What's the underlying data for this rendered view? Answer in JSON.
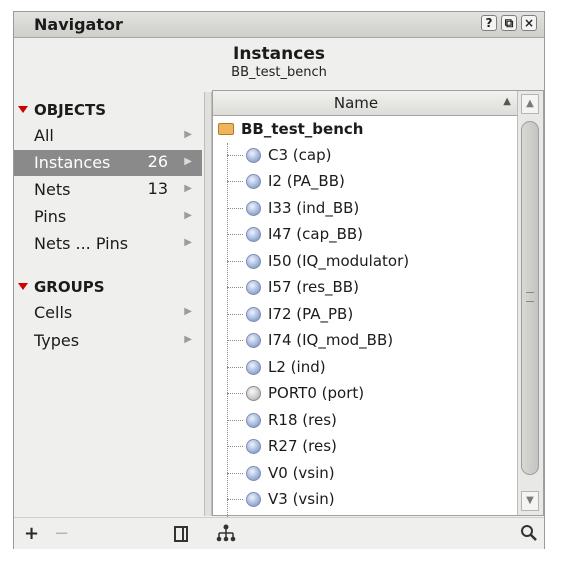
{
  "window": {
    "title": "Navigator",
    "buttons": [
      "?",
      "⧉",
      "×"
    ]
  },
  "header": {
    "title": "Instances",
    "subtitle": "BB_test_bench"
  },
  "sidebar": {
    "objects_label": "OBJECTS",
    "objects": [
      {
        "label": "All",
        "count": ""
      },
      {
        "label": "Instances",
        "count": "26"
      },
      {
        "label": "Nets",
        "count": "13"
      },
      {
        "label": "Pins",
        "count": ""
      },
      {
        "label": "Nets ... Pins",
        "count": ""
      }
    ],
    "selected": "Instances",
    "groups_label": "GROUPS",
    "groups": [
      {
        "label": "Cells"
      },
      {
        "label": "Types"
      }
    ]
  },
  "table": {
    "column_name": "Name",
    "root": "BB_test_bench",
    "rows": [
      {
        "label": "C3 (cap)",
        "icon": "instance-icon"
      },
      {
        "label": "I2 (PA_BB)",
        "icon": "instance-icon"
      },
      {
        "label": "I33 (ind_BB)",
        "icon": "instance-icon"
      },
      {
        "label": "I47 (cap_BB)",
        "icon": "instance-icon"
      },
      {
        "label": "I50 (IQ_modulator)",
        "icon": "instance-icon"
      },
      {
        "label": "I57 (res_BB)",
        "icon": "instance-icon"
      },
      {
        "label": "I72 (PA_PB)",
        "icon": "instance-icon"
      },
      {
        "label": "I74 (IQ_mod_BB)",
        "icon": "instance-icon"
      },
      {
        "label": "L2 (ind)",
        "icon": "instance-icon"
      },
      {
        "label": "PORT0 (port)",
        "icon": "port-icon"
      },
      {
        "label": "R18 (res)",
        "icon": "instance-icon"
      },
      {
        "label": "R27 (res)",
        "icon": "instance-icon"
      },
      {
        "label": "V0 (vsin)",
        "icon": "instance-icon"
      },
      {
        "label": "V3 (vsin)",
        "icon": "instance-icon"
      }
    ]
  },
  "footer": {
    "add": "+",
    "remove": "−"
  },
  "colors": {
    "selected_bg": "#8a8a8a",
    "accent_triangle": "#d10000"
  }
}
